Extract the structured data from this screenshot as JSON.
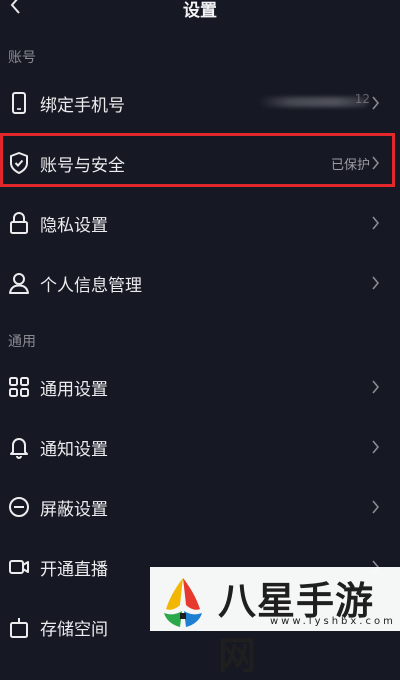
{
  "header": {
    "title": "设置",
    "back_icon": "chevron-left-icon"
  },
  "sections": {
    "account": "账号",
    "general": "通用"
  },
  "rows": {
    "bind_phone": {
      "label": "绑定手机号",
      "icon": "phone-icon",
      "value": "12"
    },
    "account_security": {
      "label": "账号与安全",
      "icon": "shield-icon",
      "value": "已保护"
    },
    "privacy": {
      "label": "隐私设置",
      "icon": "lock-icon"
    },
    "personal_info": {
      "label": "个人信息管理",
      "icon": "user-icon"
    },
    "general_settings": {
      "label": "通用设置",
      "icon": "grid-icon"
    },
    "notifications": {
      "label": "通知设置",
      "icon": "bell-icon"
    },
    "block": {
      "label": "屏蔽设置",
      "icon": "block-icon"
    },
    "live": {
      "label": "开通直播",
      "icon": "video-icon"
    },
    "storage": {
      "label": "存储空间",
      "icon": "storage-icon"
    }
  },
  "watermark": {
    "text": "八星手游网",
    "url": "www.lyshbx.com"
  },
  "colors": {
    "background": "#161823",
    "highlight": "#e1262c",
    "text": "#ececee",
    "muted": "#8a8b91"
  }
}
